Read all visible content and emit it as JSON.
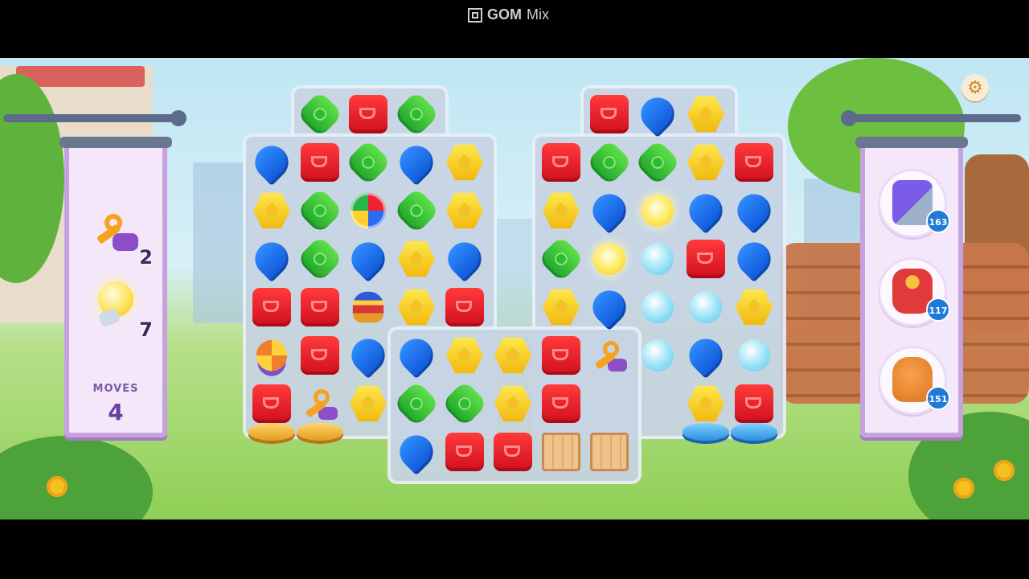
{
  "watermark": {
    "brand": "GOM",
    "product": "Mix"
  },
  "left_panel": {
    "goals": [
      {
        "icon": "key-icon",
        "count": "2"
      },
      {
        "icon": "lightbulb-icon",
        "count": "7"
      }
    ],
    "moves_label": "Moves",
    "moves_value": "4"
  },
  "right_panel": {
    "boosters": [
      {
        "icon": "hammer-icon",
        "count": "163"
      },
      {
        "icon": "fire-hydrant-icon",
        "count": "117"
      },
      {
        "icon": "glove-icon",
        "count": "151"
      }
    ]
  },
  "settings_icon": "gear-icon",
  "board": {
    "legend": {
      "R": "red-cup-tile",
      "G": "green-apple-tile",
      "B": "blue-drop-tile",
      "Y": "yellow-house-tile",
      "L": "lightbulb-tile",
      "W": "water-lamp-tile",
      "K": "key-tile",
      "C": "crate-tile",
      "X": "rainbow-ball-tile",
      "T": "spinning-top-tile",
      "P": "pinwheel-tile",
      ".": "empty-cell",
      "-": "no-cell"
    },
    "rows": [
      [
        "-",
        "G",
        "R",
        "G",
        "-",
        "-",
        "-",
        "R",
        "B",
        "Y",
        "-"
      ],
      [
        "B",
        "R",
        "G",
        "B",
        "Y",
        "-",
        "R",
        "G",
        "G",
        "Y",
        "R"
      ],
      [
        "Y",
        "G",
        "X",
        "G",
        "Y",
        "-",
        "Y",
        "B",
        "L",
        "B",
        "B"
      ],
      [
        "B",
        "G",
        "B",
        "Y",
        "B",
        "-",
        "G",
        "L",
        "W",
        "R",
        "B"
      ],
      [
        "R",
        "R",
        "T",
        "Y",
        "R",
        "-",
        "Y",
        "B",
        "W",
        "W",
        "Y"
      ],
      [
        "P",
        "R",
        "B",
        "B",
        "Y",
        "Y",
        "R",
        "K",
        "W",
        "B",
        "W"
      ],
      [
        "R",
        "K",
        "Y",
        "G",
        "G",
        "Y",
        "R",
        ".",
        ".",
        "Y",
        "R"
      ],
      [
        "-",
        "-",
        "-",
        "B",
        "R",
        "R",
        "C",
        "C",
        "-",
        "-",
        "-"
      ]
    ]
  }
}
